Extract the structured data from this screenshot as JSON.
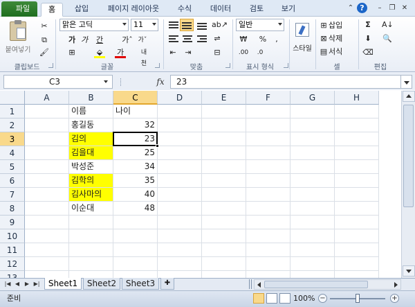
{
  "ribbon": {
    "file_tab": "파일",
    "tabs": [
      "홈",
      "삽입",
      "페이지 레이아웃",
      "수식",
      "데이터",
      "검토",
      "보기"
    ],
    "active_tab": "홈",
    "groups": {
      "clipboard": {
        "label": "클립보드",
        "paste_label": "붙여넣기"
      },
      "font": {
        "label": "글꼴",
        "font_name": "맑은 고딕",
        "font_size": "11"
      },
      "alignment": {
        "label": "맞춤"
      },
      "number": {
        "label": "표시 형식",
        "format": "일반"
      },
      "styles": {
        "label": "스타일",
        "styles_button": "스타일"
      },
      "cells": {
        "label": "셀",
        "insert": "삽입",
        "delete": "삭제",
        "format": "서식"
      },
      "editing": {
        "label": "편집"
      }
    }
  },
  "formula_bar": {
    "name_box": "C3",
    "fx": "fx",
    "value": "23"
  },
  "grid": {
    "columns": [
      "A",
      "B",
      "C",
      "D",
      "E",
      "F",
      "G",
      "H"
    ],
    "selected_column": "C",
    "row_numbers": [
      "1",
      "2",
      "3",
      "4",
      "5",
      "6",
      "7",
      "8",
      "9",
      "10",
      "11",
      "12",
      "13"
    ],
    "selected_row": "3",
    "selected_cell": "C3",
    "highlight_color": "#ffff00",
    "rows": [
      {
        "b": "이름",
        "c": "나이",
        "hl": false
      },
      {
        "b": "홍길동",
        "c": "32",
        "hl": false
      },
      {
        "b": "김의",
        "c": "23",
        "hl": true
      },
      {
        "b": "김을대",
        "c": "25",
        "hl": true
      },
      {
        "b": "박성준",
        "c": "34",
        "hl": false
      },
      {
        "b": "김학의",
        "c": "35",
        "hl": true
      },
      {
        "b": "김사마의",
        "c": "40",
        "hl": true
      },
      {
        "b": "이순대",
        "c": "48",
        "hl": false
      }
    ]
  },
  "sheets": {
    "tabs": [
      "Sheet1",
      "Sheet2",
      "Sheet3"
    ],
    "active": "Sheet1"
  },
  "status_bar": {
    "status": "준비",
    "zoom": "100%",
    "zoom_minus": "−",
    "zoom_plus": "+"
  }
}
